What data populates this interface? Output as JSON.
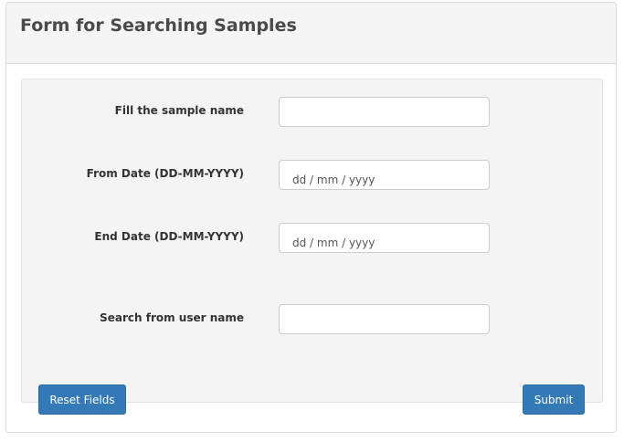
{
  "panel": {
    "title": "Form for Searching Samples"
  },
  "form": {
    "sample_name": {
      "label": "Fill the sample name",
      "value": "",
      "placeholder": ""
    },
    "from_date": {
      "label": "From Date (DD-MM-YYYY)",
      "placeholder": "dd / mm / yyyy"
    },
    "end_date": {
      "label": "End Date (DD-MM-YYYY)",
      "placeholder": "dd / mm / yyyy"
    },
    "user_name": {
      "label": "Search from user name",
      "value": "",
      "placeholder": ""
    }
  },
  "buttons": {
    "reset_label": "Reset Fields",
    "submit_label": "Submit"
  },
  "colors": {
    "primary": "#337ab7",
    "header_bg": "#f5f5f5",
    "well_bg": "#f4f4f4"
  }
}
